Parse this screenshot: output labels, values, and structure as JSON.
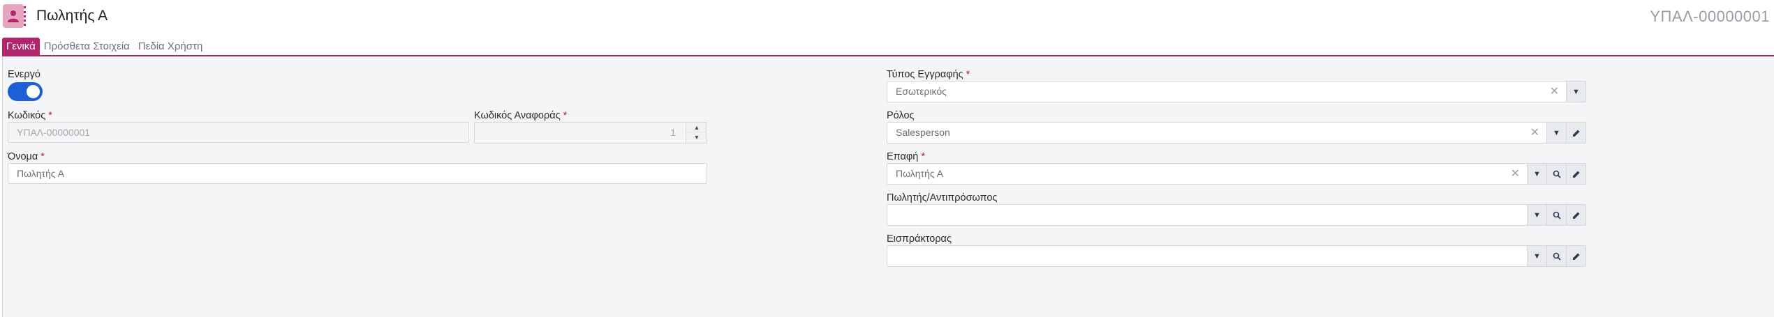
{
  "header": {
    "title": "Πωλητής Α",
    "doc_code": "ΥΠΑΛ-00000001",
    "icon": "user-card-icon"
  },
  "tabs": [
    {
      "label": "Γενικά",
      "active": true
    },
    {
      "label": "Πρόσθετα Στοιχεία",
      "active": false
    },
    {
      "label": "Πεδία Χρήστη",
      "active": false
    }
  ],
  "form": {
    "active": {
      "label": "Ενεργό",
      "value": true
    },
    "code": {
      "label": "Κωδικός",
      "value": "ΥΠΑΛ-00000001",
      "required": "*"
    },
    "ref_code": {
      "label": "Κωδικός Αναφοράς",
      "value": "1",
      "required": "*"
    },
    "name": {
      "label": "Όνομα",
      "value": "Πωλητής Α",
      "required": "*"
    },
    "record_type": {
      "label": "Τύπος Εγγραφής",
      "value": "Εσωτερικός",
      "required": "*"
    },
    "role": {
      "label": "Ρόλος",
      "value": "Salesperson"
    },
    "contact": {
      "label": "Επαφή",
      "value": "Πωλητής Α",
      "required": "*"
    },
    "salesperson": {
      "label": "Πωλητής/Αντιπρόσωπος",
      "value": ""
    },
    "collector": {
      "label": "Εισπράκτορας",
      "value": ""
    }
  },
  "colors": {
    "accent": "#b0266a",
    "toggle_on": "#1f5fd6",
    "panel_bg": "#f3f5f7"
  }
}
